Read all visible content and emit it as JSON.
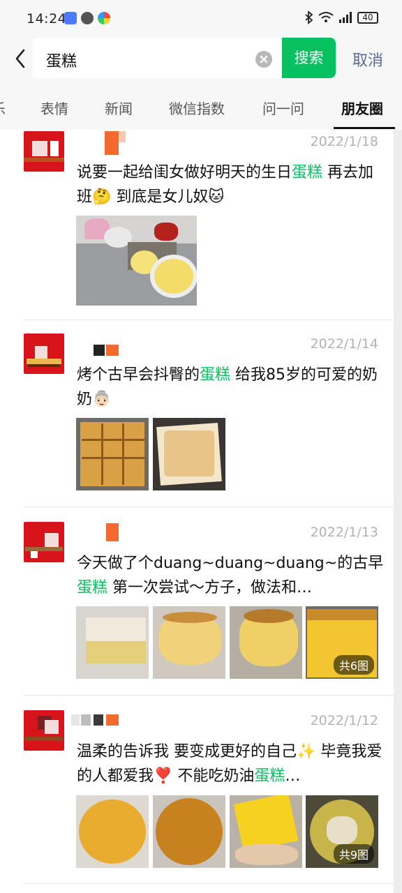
{
  "status_bar": {
    "time": "14:24",
    "battery": "40"
  },
  "search": {
    "query": "蛋糕",
    "search_label": "搜索",
    "cancel_label": "取消"
  },
  "tabs": [
    {
      "label": "乐"
    },
    {
      "label": "表情"
    },
    {
      "label": "新闻"
    },
    {
      "label": "微信指数"
    },
    {
      "label": "问一问"
    },
    {
      "label": "朋友圈",
      "active": true
    }
  ],
  "posts": [
    {
      "date": "2022/1/18",
      "text_before": "说要一起给闺女做好明天的生日",
      "keyword": "蛋糕",
      "text_after": " 再去加班🤔 到底是女儿奴🐱",
      "image_count_label": ""
    },
    {
      "date": "2022/1/14",
      "text_before": "烤个古早会抖臀的",
      "keyword": "蛋糕",
      "text_after": " 给我85岁的可爱的奶奶👵🏻",
      "image_count_label": ""
    },
    {
      "date": "2022/1/13",
      "text_before": "今天做了个duang~duang~duang~的古早",
      "keyword": "蛋糕",
      "text_after": " 第一次尝试～方子，做法和…",
      "image_count_label": "共6图"
    },
    {
      "date": "2022/1/12",
      "text_before": "温柔的告诉我 要变成更好的自己✨ 毕竟我爱的人都爱我❣️ 不能吃奶油",
      "keyword": "蛋糕",
      "text_after": "…",
      "image_count_label": "共9图"
    }
  ]
}
